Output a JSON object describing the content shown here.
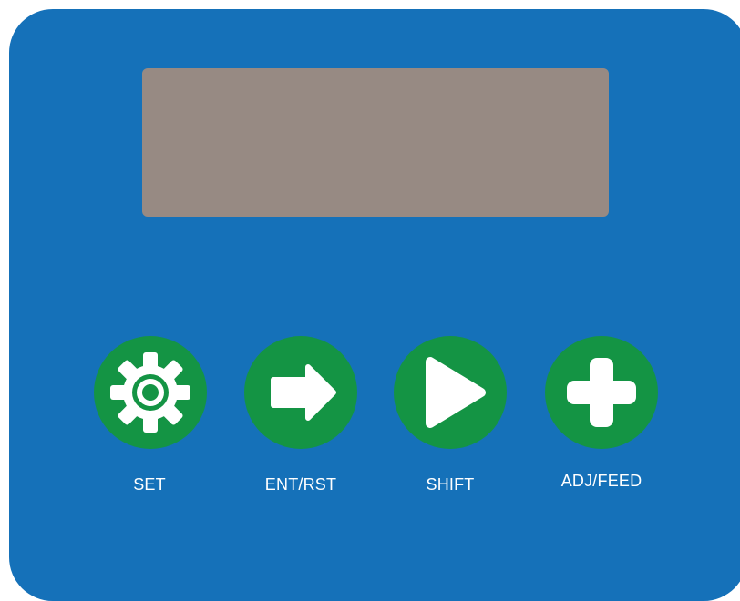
{
  "colors": {
    "panel": "#1571b9",
    "display": "#978a83",
    "button": "#149444",
    "icon": "#ffffff",
    "label": "#ffffff"
  },
  "buttons": [
    {
      "id": "set",
      "label": "SET",
      "icon": "gear-icon"
    },
    {
      "id": "ent_rst",
      "label": "ENT/RST",
      "icon": "arrow-right-icon"
    },
    {
      "id": "shift",
      "label": "SHIFT",
      "icon": "play-icon"
    },
    {
      "id": "adj_feed",
      "label": "ADJ/FEED",
      "icon": "plus-icon"
    }
  ]
}
